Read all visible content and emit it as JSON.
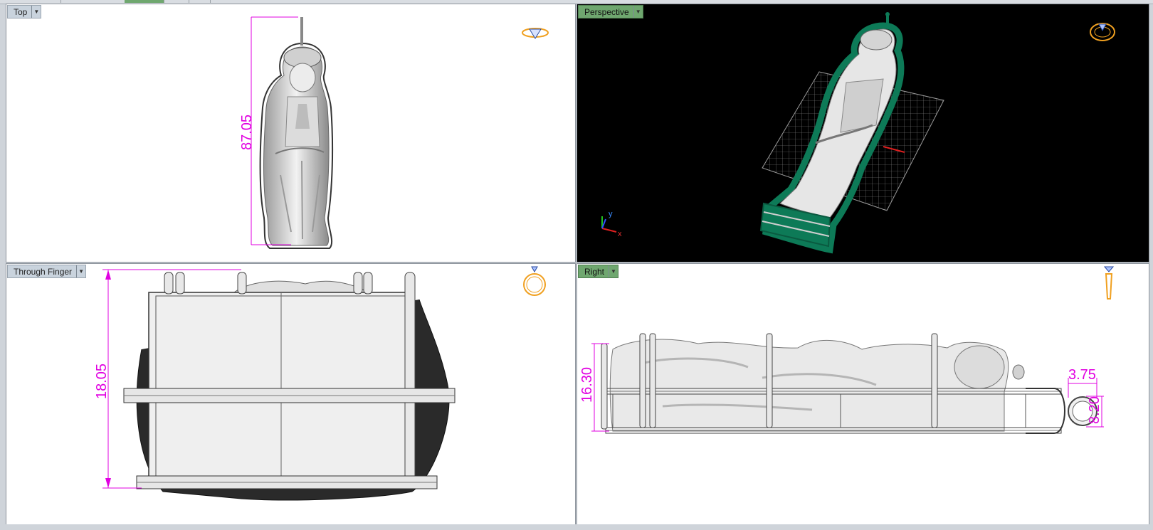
{
  "viewports": {
    "top": {
      "label": "Top",
      "dimension": "87.05"
    },
    "perspective": {
      "label": "Perspective",
      "axis_x": "x",
      "axis_y": "y"
    },
    "through_finger": {
      "label": "Through Finger",
      "dimension": "18.05"
    },
    "right": {
      "label": "Right",
      "dim_height": "16.30",
      "dim_ring_width": "3.75",
      "dim_ring_height": "8.20"
    }
  },
  "colors": {
    "dimension": "#e100e1",
    "active_tab": "#6fa76f",
    "mold_outline": "#0d7a57",
    "gizmo": "#f0a020"
  },
  "icons": [
    "ring-diamond-top-icon",
    "ring-perspective-icon",
    "ring-front-icon",
    "ring-side-icon",
    "dropdown-arrow-icon"
  ]
}
